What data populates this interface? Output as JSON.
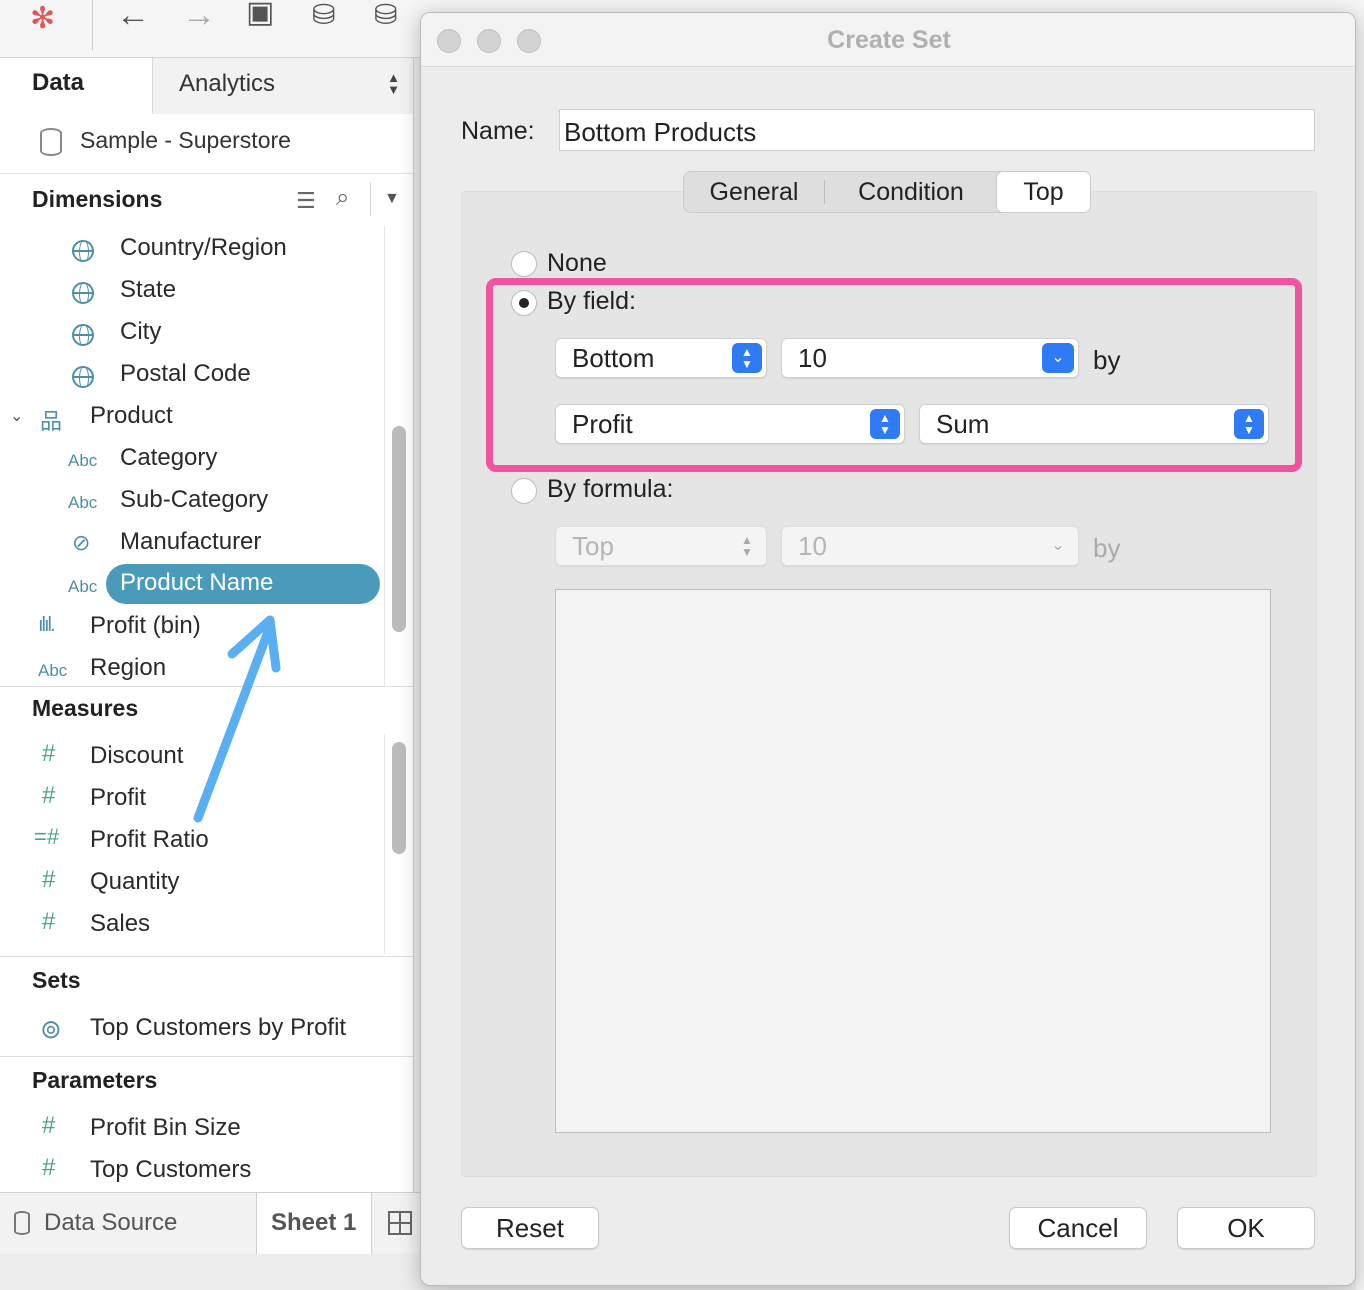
{
  "panel": {
    "tab_data": "Data",
    "tab_analytics": "Analytics",
    "datasource": "Sample - Superstore",
    "dimensions_header": "Dimensions",
    "dimensions": [
      {
        "icon": "globe-icon",
        "label": "Country/Region"
      },
      {
        "icon": "globe-icon",
        "label": "State"
      },
      {
        "icon": "globe-icon",
        "label": "City"
      },
      {
        "icon": "globe-icon",
        "label": "Postal Code"
      },
      {
        "icon": "hierarchy-icon",
        "label": "Product"
      },
      {
        "icon": "abc-icon",
        "icon_text": "Abc",
        "label": "Category"
      },
      {
        "icon": "abc-icon",
        "icon_text": "Abc",
        "label": "Sub-Category"
      },
      {
        "icon": "paperclip-icon",
        "label": "Manufacturer"
      },
      {
        "icon": "abc-icon",
        "icon_text": "Abc",
        "label": "Product Name"
      },
      {
        "icon": "histogram-icon",
        "label": "Profit (bin)"
      },
      {
        "icon": "abc-icon",
        "icon_text": "Abc",
        "label": "Region"
      }
    ],
    "measures_header": "Measures",
    "measures": [
      {
        "icon": "hash-icon",
        "label": "Discount"
      },
      {
        "icon": "hash-icon",
        "label": "Profit"
      },
      {
        "icon": "calculated-hash-icon",
        "label": "Profit Ratio"
      },
      {
        "icon": "hash-icon",
        "label": "Quantity"
      },
      {
        "icon": "hash-icon",
        "label": "Sales"
      }
    ],
    "sets_header": "Sets",
    "sets": [
      {
        "icon": "set-icon",
        "label": "Top Customers by Profit"
      }
    ],
    "parameters_header": "Parameters",
    "parameters": [
      {
        "icon": "hash-icon",
        "label": "Profit Bin Size"
      },
      {
        "icon": "hash-icon",
        "label": "Top Customers"
      }
    ]
  },
  "bottombar": {
    "datasource_tab": "Data Source",
    "sheet_tab": "Sheet 1"
  },
  "dialog": {
    "title": "Create Set",
    "name_label": "Name:",
    "name_value": "Bottom Products",
    "tabs": [
      "General",
      "Condition",
      "Top"
    ],
    "active_tab": "Top",
    "option_none": "None",
    "option_by_field": "By field:",
    "option_by_formula": "By formula:",
    "selected_option": "By field:",
    "by_field": {
      "direction": "Bottom",
      "count": "10",
      "by_text": "by",
      "field": "Profit",
      "aggregation": "Sum"
    },
    "by_formula": {
      "direction": "Top",
      "count": "10",
      "by_text": "by"
    },
    "buttons": {
      "reset": "Reset",
      "cancel": "Cancel",
      "ok": "OK"
    }
  },
  "colors": {
    "highlight": "#f0549f",
    "selection": "#4a9bbb",
    "arrow": "#5aaef2",
    "control_accent": "#2f7bf5"
  }
}
